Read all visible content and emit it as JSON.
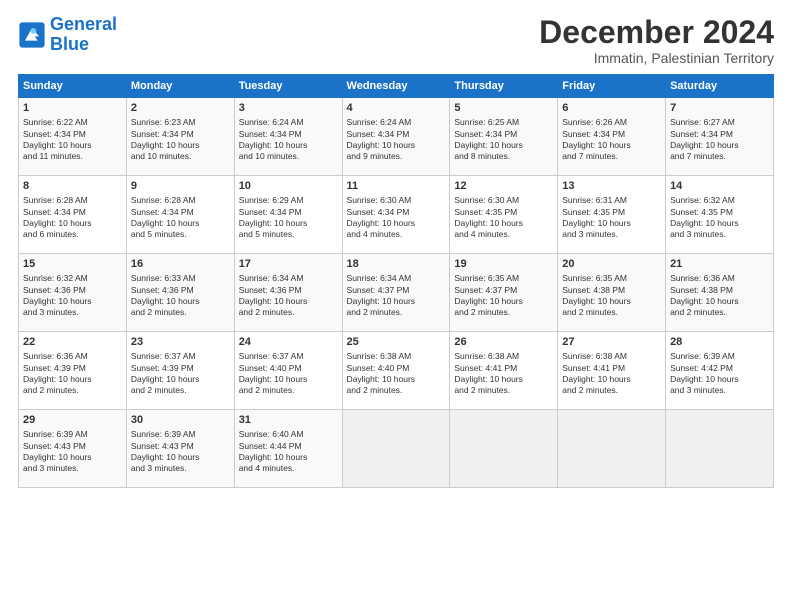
{
  "header": {
    "logo_line1": "General",
    "logo_line2": "Blue",
    "month": "December 2024",
    "location": "Immatin, Palestinian Territory"
  },
  "days_of_week": [
    "Sunday",
    "Monday",
    "Tuesday",
    "Wednesday",
    "Thursday",
    "Friday",
    "Saturday"
  ],
  "weeks": [
    [
      {
        "day": 1,
        "lines": [
          "Sunrise: 6:22 AM",
          "Sunset: 4:34 PM",
          "Daylight: 10 hours",
          "and 11 minutes."
        ]
      },
      {
        "day": 2,
        "lines": [
          "Sunrise: 6:23 AM",
          "Sunset: 4:34 PM",
          "Daylight: 10 hours",
          "and 10 minutes."
        ]
      },
      {
        "day": 3,
        "lines": [
          "Sunrise: 6:24 AM",
          "Sunset: 4:34 PM",
          "Daylight: 10 hours",
          "and 10 minutes."
        ]
      },
      {
        "day": 4,
        "lines": [
          "Sunrise: 6:24 AM",
          "Sunset: 4:34 PM",
          "Daylight: 10 hours",
          "and 9 minutes."
        ]
      },
      {
        "day": 5,
        "lines": [
          "Sunrise: 6:25 AM",
          "Sunset: 4:34 PM",
          "Daylight: 10 hours",
          "and 8 minutes."
        ]
      },
      {
        "day": 6,
        "lines": [
          "Sunrise: 6:26 AM",
          "Sunset: 4:34 PM",
          "Daylight: 10 hours",
          "and 7 minutes."
        ]
      },
      {
        "day": 7,
        "lines": [
          "Sunrise: 6:27 AM",
          "Sunset: 4:34 PM",
          "Daylight: 10 hours",
          "and 7 minutes."
        ]
      }
    ],
    [
      {
        "day": 8,
        "lines": [
          "Sunrise: 6:28 AM",
          "Sunset: 4:34 PM",
          "Daylight: 10 hours",
          "and 6 minutes."
        ]
      },
      {
        "day": 9,
        "lines": [
          "Sunrise: 6:28 AM",
          "Sunset: 4:34 PM",
          "Daylight: 10 hours",
          "and 5 minutes."
        ]
      },
      {
        "day": 10,
        "lines": [
          "Sunrise: 6:29 AM",
          "Sunset: 4:34 PM",
          "Daylight: 10 hours",
          "and 5 minutes."
        ]
      },
      {
        "day": 11,
        "lines": [
          "Sunrise: 6:30 AM",
          "Sunset: 4:34 PM",
          "Daylight: 10 hours",
          "and 4 minutes."
        ]
      },
      {
        "day": 12,
        "lines": [
          "Sunrise: 6:30 AM",
          "Sunset: 4:35 PM",
          "Daylight: 10 hours",
          "and 4 minutes."
        ]
      },
      {
        "day": 13,
        "lines": [
          "Sunrise: 6:31 AM",
          "Sunset: 4:35 PM",
          "Daylight: 10 hours",
          "and 3 minutes."
        ]
      },
      {
        "day": 14,
        "lines": [
          "Sunrise: 6:32 AM",
          "Sunset: 4:35 PM",
          "Daylight: 10 hours",
          "and 3 minutes."
        ]
      }
    ],
    [
      {
        "day": 15,
        "lines": [
          "Sunrise: 6:32 AM",
          "Sunset: 4:36 PM",
          "Daylight: 10 hours",
          "and 3 minutes."
        ]
      },
      {
        "day": 16,
        "lines": [
          "Sunrise: 6:33 AM",
          "Sunset: 4:36 PM",
          "Daylight: 10 hours",
          "and 2 minutes."
        ]
      },
      {
        "day": 17,
        "lines": [
          "Sunrise: 6:34 AM",
          "Sunset: 4:36 PM",
          "Daylight: 10 hours",
          "and 2 minutes."
        ]
      },
      {
        "day": 18,
        "lines": [
          "Sunrise: 6:34 AM",
          "Sunset: 4:37 PM",
          "Daylight: 10 hours",
          "and 2 minutes."
        ]
      },
      {
        "day": 19,
        "lines": [
          "Sunrise: 6:35 AM",
          "Sunset: 4:37 PM",
          "Daylight: 10 hours",
          "and 2 minutes."
        ]
      },
      {
        "day": 20,
        "lines": [
          "Sunrise: 6:35 AM",
          "Sunset: 4:38 PM",
          "Daylight: 10 hours",
          "and 2 minutes."
        ]
      },
      {
        "day": 21,
        "lines": [
          "Sunrise: 6:36 AM",
          "Sunset: 4:38 PM",
          "Daylight: 10 hours",
          "and 2 minutes."
        ]
      }
    ],
    [
      {
        "day": 22,
        "lines": [
          "Sunrise: 6:36 AM",
          "Sunset: 4:39 PM",
          "Daylight: 10 hours",
          "and 2 minutes."
        ]
      },
      {
        "day": 23,
        "lines": [
          "Sunrise: 6:37 AM",
          "Sunset: 4:39 PM",
          "Daylight: 10 hours",
          "and 2 minutes."
        ]
      },
      {
        "day": 24,
        "lines": [
          "Sunrise: 6:37 AM",
          "Sunset: 4:40 PM",
          "Daylight: 10 hours",
          "and 2 minutes."
        ]
      },
      {
        "day": 25,
        "lines": [
          "Sunrise: 6:38 AM",
          "Sunset: 4:40 PM",
          "Daylight: 10 hours",
          "and 2 minutes."
        ]
      },
      {
        "day": 26,
        "lines": [
          "Sunrise: 6:38 AM",
          "Sunset: 4:41 PM",
          "Daylight: 10 hours",
          "and 2 minutes."
        ]
      },
      {
        "day": 27,
        "lines": [
          "Sunrise: 6:38 AM",
          "Sunset: 4:41 PM",
          "Daylight: 10 hours",
          "and 2 minutes."
        ]
      },
      {
        "day": 28,
        "lines": [
          "Sunrise: 6:39 AM",
          "Sunset: 4:42 PM",
          "Daylight: 10 hours",
          "and 3 minutes."
        ]
      }
    ],
    [
      {
        "day": 29,
        "lines": [
          "Sunrise: 6:39 AM",
          "Sunset: 4:43 PM",
          "Daylight: 10 hours",
          "and 3 minutes."
        ]
      },
      {
        "day": 30,
        "lines": [
          "Sunrise: 6:39 AM",
          "Sunset: 4:43 PM",
          "Daylight: 10 hours",
          "and 3 minutes."
        ]
      },
      {
        "day": 31,
        "lines": [
          "Sunrise: 6:40 AM",
          "Sunset: 4:44 PM",
          "Daylight: 10 hours",
          "and 4 minutes."
        ]
      },
      null,
      null,
      null,
      null
    ]
  ]
}
